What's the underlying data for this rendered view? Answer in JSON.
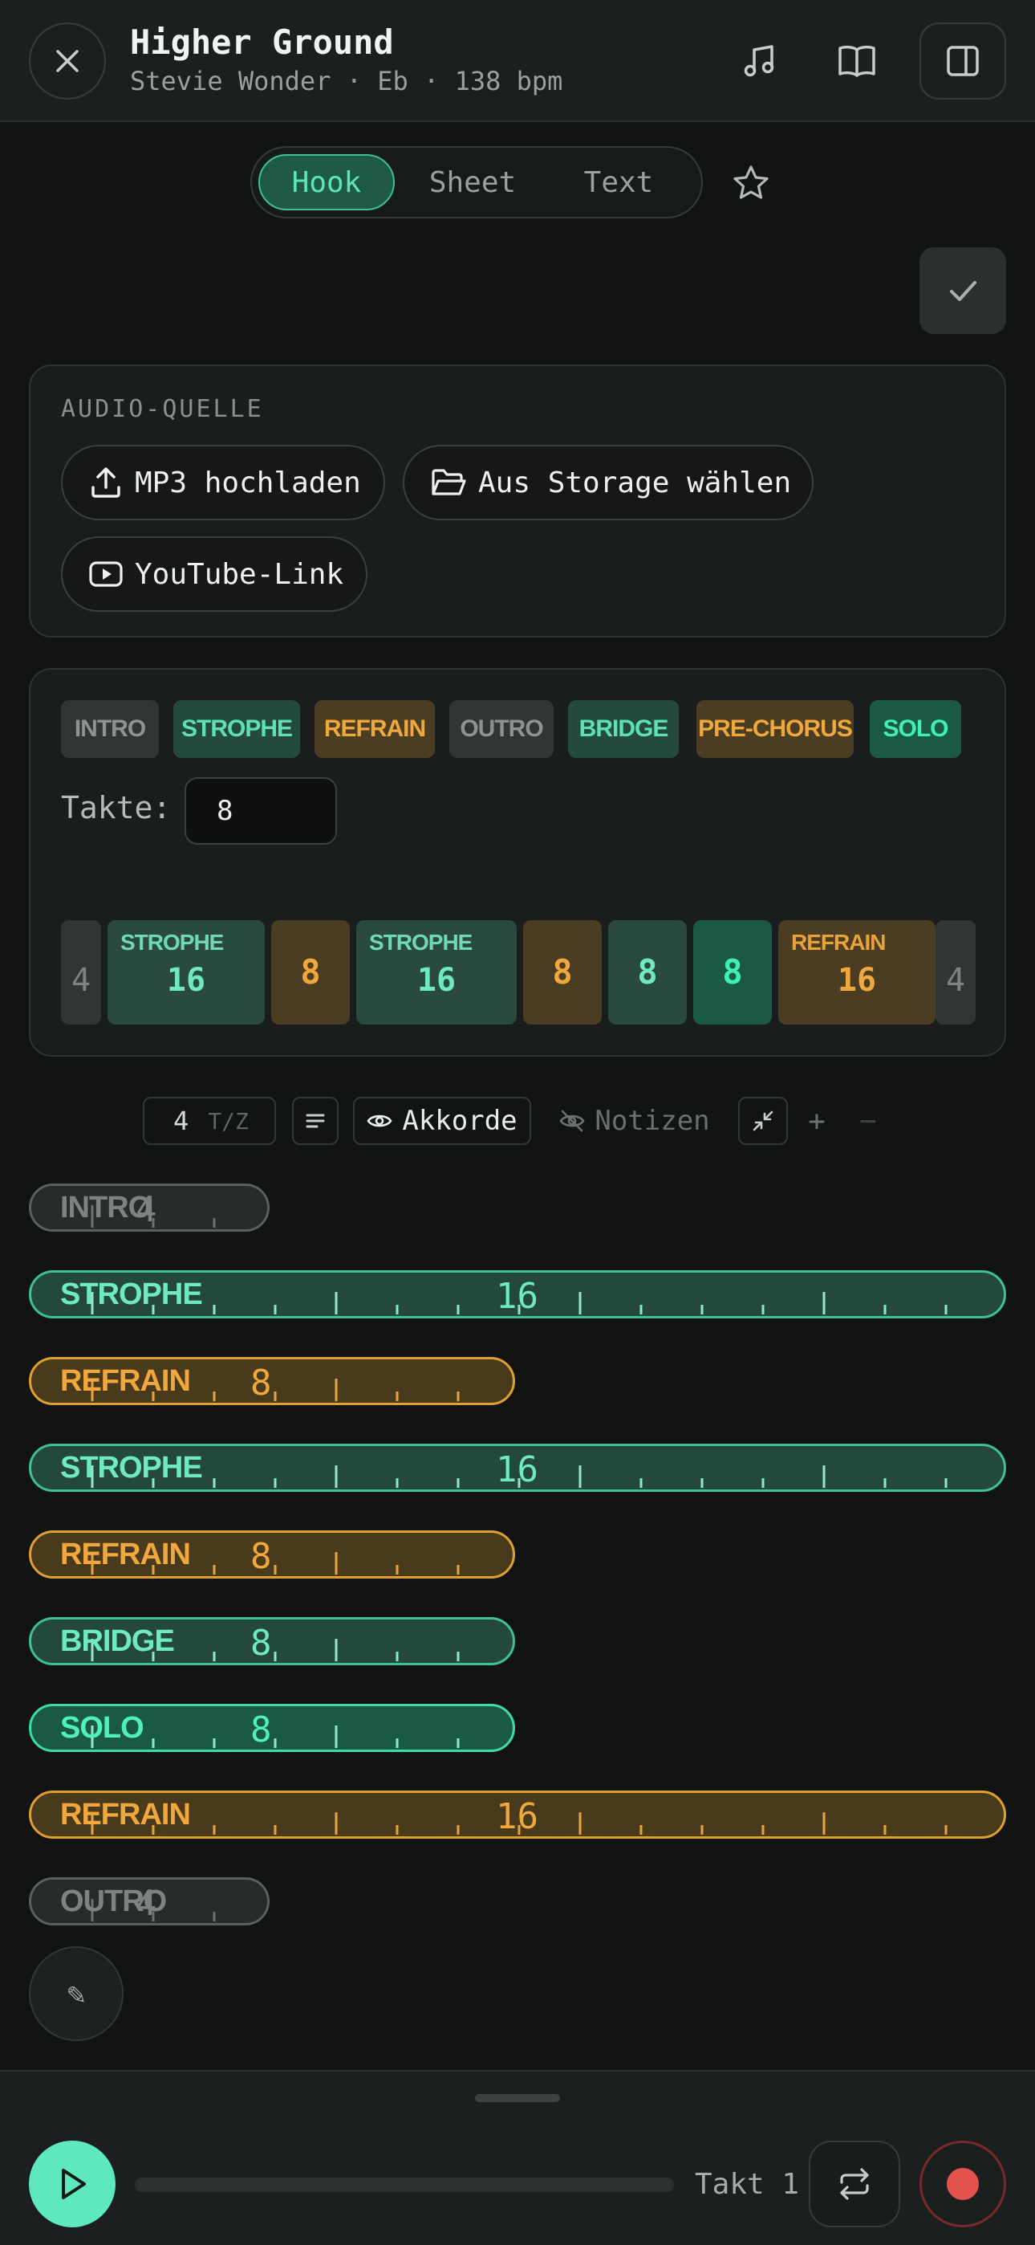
{
  "header": {
    "title": "Higher Ground",
    "subtitle": "Stevie Wonder · Eb · 138 bpm",
    "icons": [
      "close-icon",
      "music-note-icon",
      "book-icon",
      "sidebar-panel-icon"
    ]
  },
  "view_tabs": [
    {
      "label": "Hook",
      "active": true
    },
    {
      "label": "Sheet",
      "active": false
    },
    {
      "label": "Text",
      "active": false
    }
  ],
  "audio": {
    "label": "AUDIO-QUELLE",
    "buttons": [
      {
        "label": "MP3 hochladen",
        "icon": "upload-icon"
      },
      {
        "label": "Aus Storage wählen",
        "icon": "folder-icon"
      },
      {
        "label": "YouTube-Link",
        "icon": "youtube-icon"
      }
    ]
  },
  "section_chips": [
    {
      "label": "INTRO",
      "kind": "grey"
    },
    {
      "label": "STROPHE",
      "kind": "teal"
    },
    {
      "label": "REFRAIN",
      "kind": "amber"
    },
    {
      "label": "OUTRO",
      "kind": "grey"
    },
    {
      "label": "BRIDGE",
      "kind": "teal"
    },
    {
      "label": "PRE-CHORUS",
      "kind": "amber"
    },
    {
      "label": "SOLO",
      "kind": "green"
    }
  ],
  "takte": {
    "label": "Takte:",
    "value": "8"
  },
  "timeline": [
    {
      "label": "",
      "bars": "4",
      "kind": "grey"
    },
    {
      "label": "STROPHE",
      "bars": "16",
      "kind": "teal"
    },
    {
      "label": "",
      "bars": "8",
      "kind": "amber"
    },
    {
      "label": "STROPHE",
      "bars": "16",
      "kind": "teal"
    },
    {
      "label": "",
      "bars": "8",
      "kind": "amber"
    },
    {
      "label": "",
      "bars": "8",
      "kind": "teal"
    },
    {
      "label": "",
      "bars": "8",
      "kind": "green"
    },
    {
      "label": "REFRAIN",
      "bars": "16",
      "kind": "amber"
    },
    {
      "label": "",
      "bars": "4",
      "kind": "grey"
    }
  ],
  "toolbar": {
    "bars_per_line": "4",
    "bars_per_line_unit": "T/Z",
    "chords_label": "Akkorde",
    "notes_label": "Notizen",
    "plus": "+",
    "minus": "−"
  },
  "sections": [
    {
      "name": "INTRO",
      "bars": "4",
      "kind": "grey"
    },
    {
      "name": "STROPHE",
      "bars": "16",
      "kind": "teal"
    },
    {
      "name": "REFRAIN",
      "bars": "8",
      "kind": "amber"
    },
    {
      "name": "STROPHE",
      "bars": "16",
      "kind": "teal"
    },
    {
      "name": "REFRAIN",
      "bars": "8",
      "kind": "amber"
    },
    {
      "name": "BRIDGE",
      "bars": "8",
      "kind": "teal"
    },
    {
      "name": "SOLO",
      "bars": "8",
      "kind": "green"
    },
    {
      "name": "REFRAIN",
      "bars": "16",
      "kind": "amber"
    },
    {
      "name": "OUTRO",
      "bars": "4",
      "kind": "grey"
    }
  ],
  "edit_icon": "✎",
  "player": {
    "takt_label": "Takt 1",
    "progress": 0
  },
  "colors": {
    "accent": "#5de8bd",
    "teal": "#3fbf95",
    "amber": "#e0a030",
    "record": "#e0524a"
  }
}
